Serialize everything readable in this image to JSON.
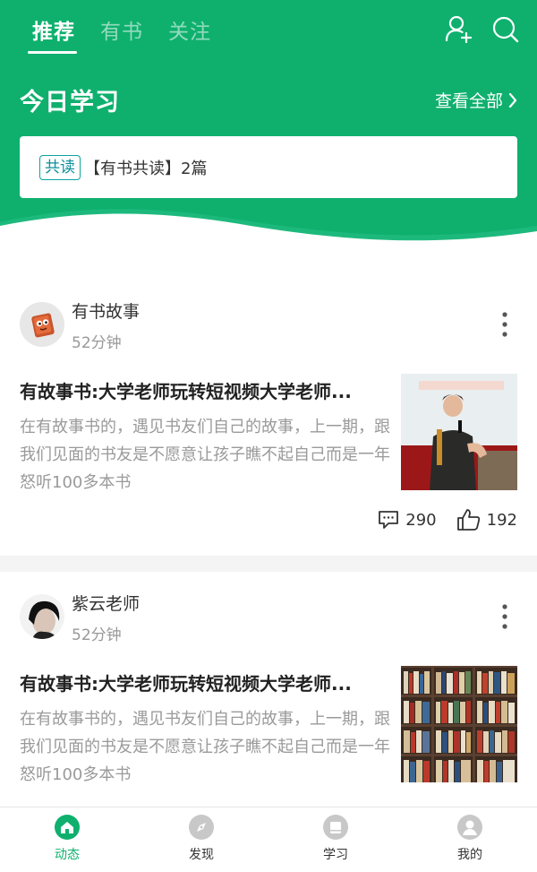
{
  "header": {
    "tabs": [
      {
        "label": "推荐",
        "active": true
      },
      {
        "label": "有书",
        "active": false
      },
      {
        "label": "关注",
        "active": false
      }
    ],
    "icons": [
      "add-user-icon",
      "search-icon"
    ],
    "section_title": "今日学习",
    "view_all_label": "查看全部",
    "reading": {
      "badge": "共读",
      "text": "【有书共读】2篇"
    },
    "colors": {
      "brand_green": "#0fb06e",
      "badge_teal": "#0aa4a0"
    }
  },
  "feed": [
    {
      "author": "有书故事",
      "time": "52分钟",
      "title": "有故事书:大学老师玩转短视频大学老师...",
      "excerpt": "在有故事书的，遇见书友们自己的故事，上一期，跟我们见面的书友是不愿意让孩子瞧不起自己而是一年怒听100多本书",
      "comments": "290",
      "likes": "192"
    },
    {
      "author": "紫云老师",
      "time": "52分钟",
      "title": "有故事书:大学老师玩转短视频大学老师...",
      "excerpt": "在有故事书的，遇见书友们自己的故事，上一期，跟我们见面的书友是不愿意让孩子瞧不起自己而是一年怒听100多本书"
    }
  ],
  "nav": [
    {
      "label": "动态",
      "icon": "home-icon",
      "active": true
    },
    {
      "label": "发现",
      "icon": "compass-icon",
      "active": false
    },
    {
      "label": "学习",
      "icon": "book-icon",
      "active": false
    },
    {
      "label": "我的",
      "icon": "profile-icon",
      "active": false
    }
  ]
}
